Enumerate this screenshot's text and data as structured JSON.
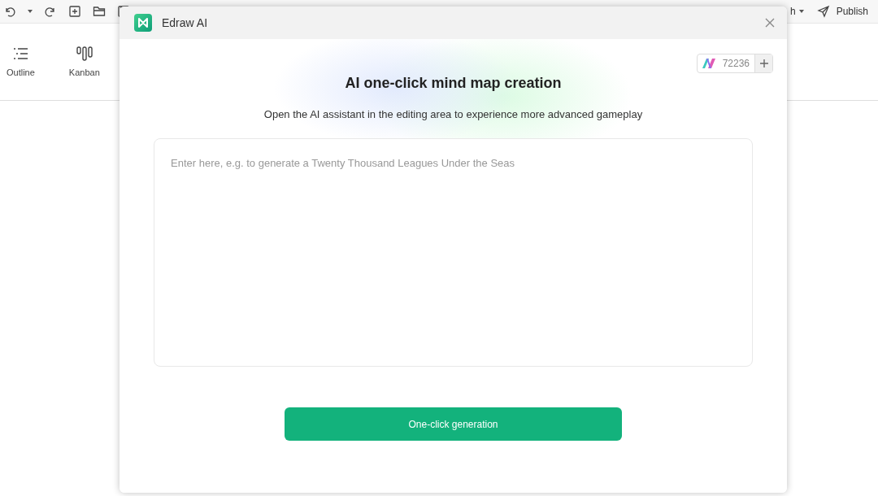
{
  "app": {
    "toolbar_partial_label": "h",
    "publish": "Publish",
    "ribbon": [
      {
        "kind": "outline",
        "label": "Outline"
      },
      {
        "kind": "kanban",
        "label": "Kanban"
      }
    ]
  },
  "dialog": {
    "title": "Edraw AI",
    "credits": "72236",
    "heading": "AI one-click mind map creation",
    "subtitle": "Open the AI assistant in the editing area to experience more advanced gameplay",
    "prompt": {
      "placeholder": "Enter here, e.g. to generate a Twenty Thousand Leagues Under the Seas"
    },
    "button": "One-click generation"
  }
}
